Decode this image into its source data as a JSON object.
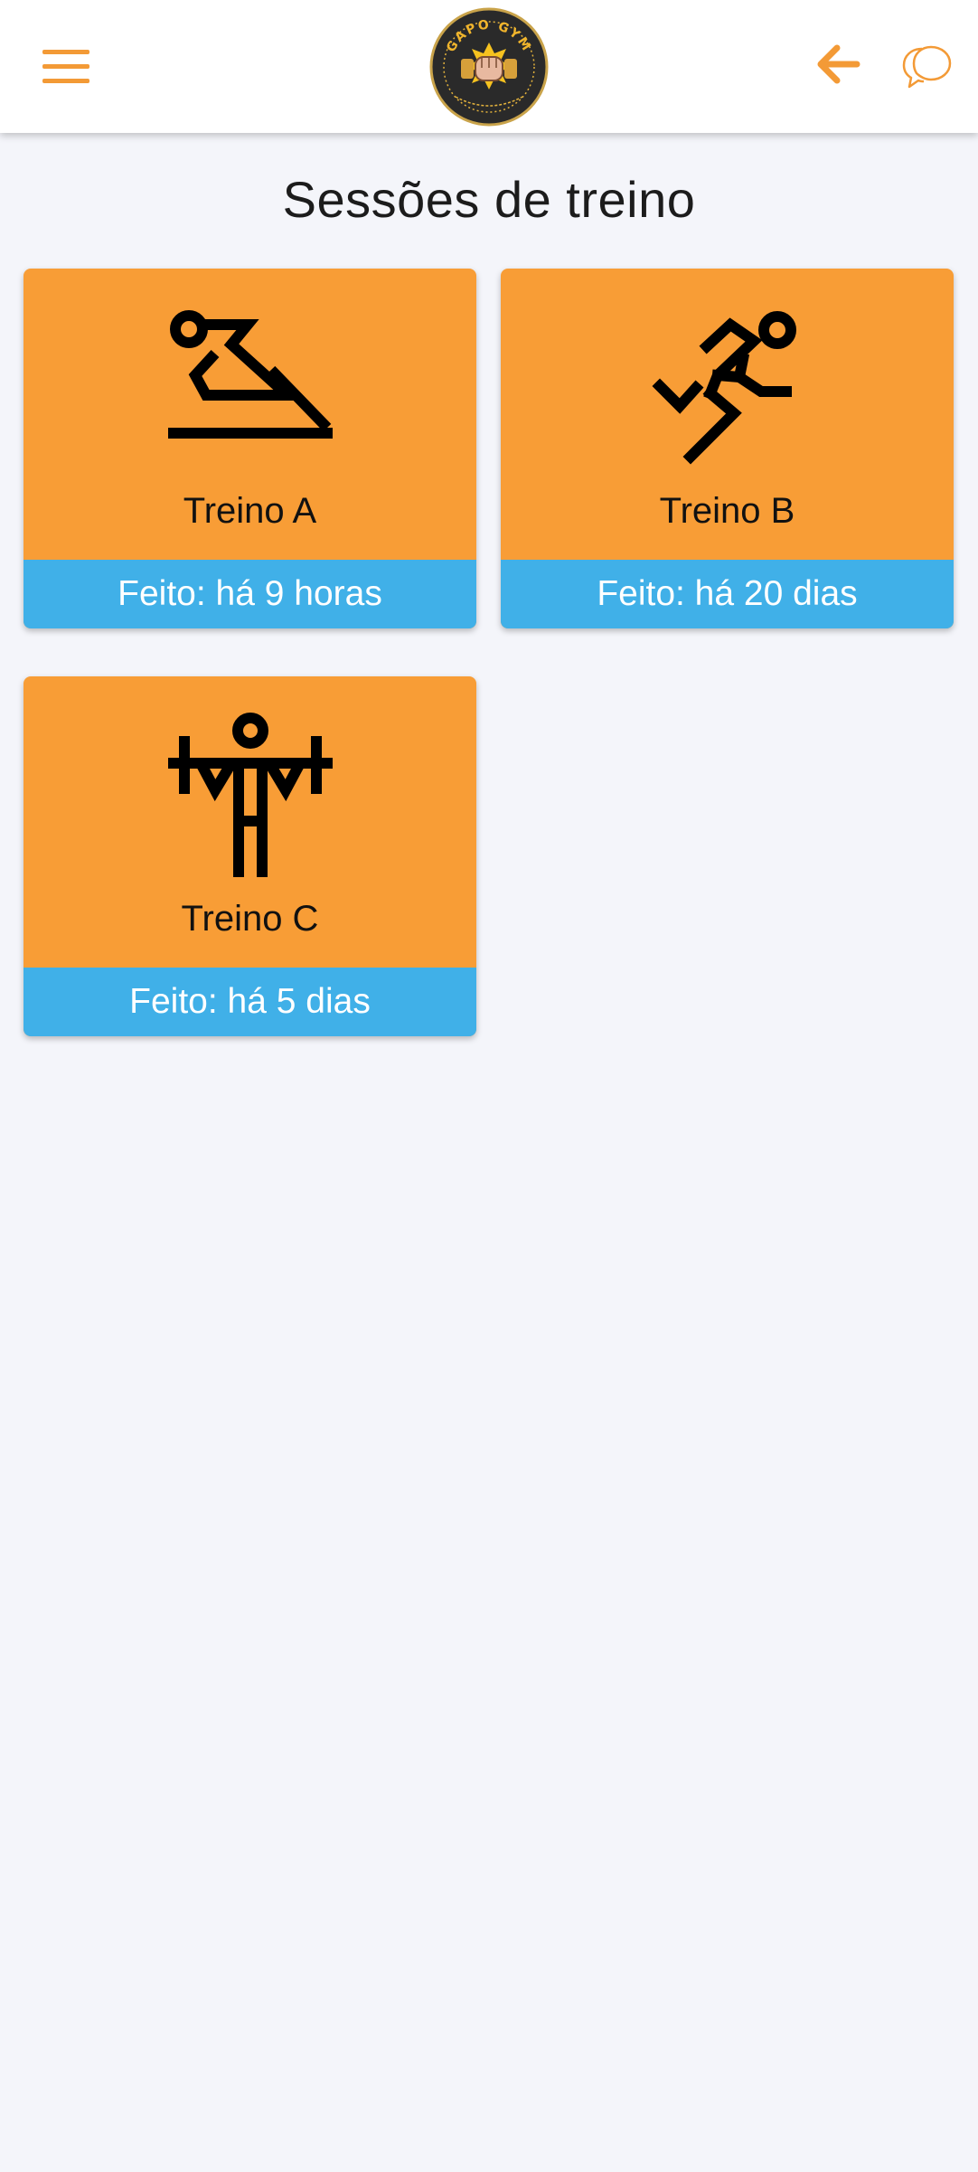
{
  "app": {
    "title": "Sessões de treino",
    "logo_text": "GAPO GYM",
    "accent_color": "#f39a36",
    "card_color": "#f89d36",
    "footer_color": "#40b0e8"
  },
  "header": {
    "menu_icon": "hamburger-menu-icon",
    "back_icon": "arrow-left-icon",
    "chat_icon": "chat-bubbles-icon"
  },
  "sessions": [
    {
      "name": "Treino A",
      "status": "Feito: há 9 horas",
      "icon": "stretching-icon"
    },
    {
      "name": "Treino B",
      "status": "Feito: há 20 dias",
      "icon": "running-icon"
    },
    {
      "name": "Treino C",
      "status": "Feito: há 5 dias",
      "icon": "weightlifting-icon"
    }
  ]
}
